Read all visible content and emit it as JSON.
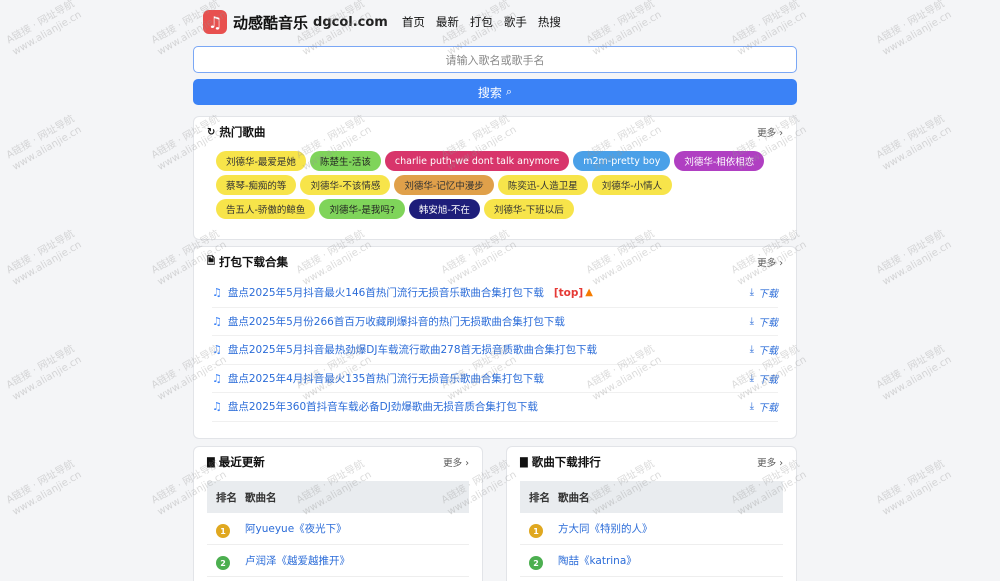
{
  "header": {
    "logo_glyph": "♫",
    "site_name": "动感酷音乐",
    "domain": "dgcol.com",
    "nav": [
      "首页",
      "最新",
      "打包",
      "歌手",
      "热搜"
    ]
  },
  "search": {
    "placeholder": "请输入歌名或歌手名",
    "button_label": "搜索"
  },
  "hot": {
    "title": "热门歌曲",
    "more": "更多 ›",
    "tags": [
      {
        "label": "刘德华-最爱是她",
        "bg": "#f7e44a",
        "fg": "#333"
      },
      {
        "label": "陈楚生-活该",
        "bg": "#7fd45a",
        "fg": "#222"
      },
      {
        "label": "charlie puth-we dont talk anymore",
        "bg": "#d8356b",
        "fg": "#fff"
      },
      {
        "label": "m2m-pretty boy",
        "bg": "#4aa0e8",
        "fg": "#fff"
      },
      {
        "label": "刘德华-相依相恋",
        "bg": "#b03fc2",
        "fg": "#fff"
      },
      {
        "label": "蔡琴-痴痴的等",
        "bg": "#f7e44a",
        "fg": "#333"
      },
      {
        "label": "刘德华-不该情感",
        "bg": "#f7e44a",
        "fg": "#333"
      },
      {
        "label": "刘德华-记忆中漫步",
        "bg": "#e0a04a",
        "fg": "#333"
      },
      {
        "label": "陈奕迅-人造卫星",
        "bg": "#f7e44a",
        "fg": "#333"
      },
      {
        "label": "刘德华-小情人",
        "bg": "#f7e44a",
        "fg": "#333"
      },
      {
        "label": "告五人-骄傲的鲸鱼",
        "bg": "#f7e44a",
        "fg": "#333"
      },
      {
        "label": "刘德华-是我吗?",
        "bg": "#7fd45a",
        "fg": "#222"
      },
      {
        "label": "韩安旭-不在",
        "bg": "#1e1e7a",
        "fg": "#fff"
      },
      {
        "label": "刘德华-下班以后",
        "bg": "#f7e44a",
        "fg": "#333"
      }
    ]
  },
  "packs": {
    "title": "打包下载合集",
    "more": "更多 ›",
    "download_label": "下载",
    "top_label": "[top]",
    "items": [
      "盘点2025年5月抖音最火146首热门流行无损音乐歌曲合集打包下载",
      "盘点2025年5月份266首百万收藏刷爆抖音的热门无损歌曲合集打包下载",
      "盘点2025年5月抖音最热劲爆DJ车载流行歌曲278首无损音质歌曲合集打包下载",
      "盘点2025年4月抖音最火135首热门流行无损音乐歌曲合集打包下载",
      "盘点2025年360首抖音车载必备DJ劲爆歌曲无损音质合集打包下载"
    ]
  },
  "latest": {
    "title": "最近更新",
    "more": "更多 ›",
    "col_rank": "排名",
    "col_name": "歌曲名",
    "rows": [
      {
        "rank": "1",
        "name": "阿yueyue《夜光下》",
        "color": "#e0a820"
      },
      {
        "rank": "2",
        "name": "卢润泽《越爱越推开》",
        "color": "#4caf50"
      }
    ]
  },
  "ranking": {
    "title": "歌曲下载排行",
    "more": "更多 ›",
    "col_rank": "排名",
    "col_name": "歌曲名",
    "rows": [
      {
        "rank": "1",
        "name": "方大同《特别的人》",
        "color": "#e0a820"
      },
      {
        "rank": "2",
        "name": "陶喆《katrina》",
        "color": "#4caf50"
      }
    ]
  },
  "watermark": {
    "line1": "A链接 · 网址导航",
    "line2": "www.alianjie.cn"
  }
}
